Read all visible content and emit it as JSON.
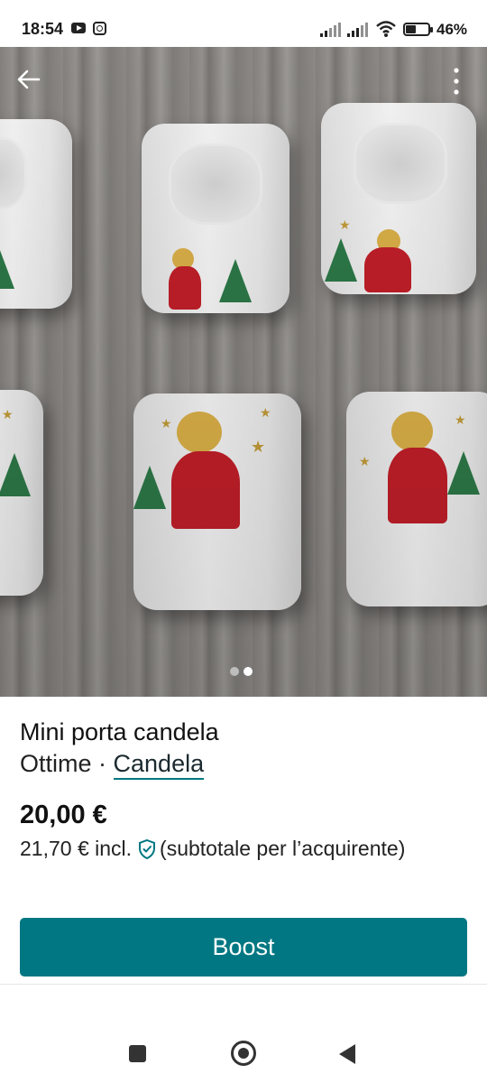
{
  "status_bar": {
    "time": "18:54",
    "battery_percent": "46%",
    "battery_level": 0.46
  },
  "photo": {
    "alt_icons": [
      "back-arrow-icon",
      "more-vertical-icon"
    ],
    "carousel_total": 2,
    "carousel_active": 2,
    "colors": {
      "dot_active": "#ffffff",
      "dot_inactive": "#bdbdbd"
    }
  },
  "item": {
    "title": "Mini porta candela",
    "condition": "Ottime",
    "separator": " · ",
    "brand": "Candela",
    "price": "20,00 €",
    "price_incl": "21,70 € incl.",
    "price_note": "(subtotale per l’acquirente)"
  },
  "actions": {
    "boost_label": "Boost"
  },
  "colors": {
    "accent": "#007782",
    "text": "#111111"
  }
}
